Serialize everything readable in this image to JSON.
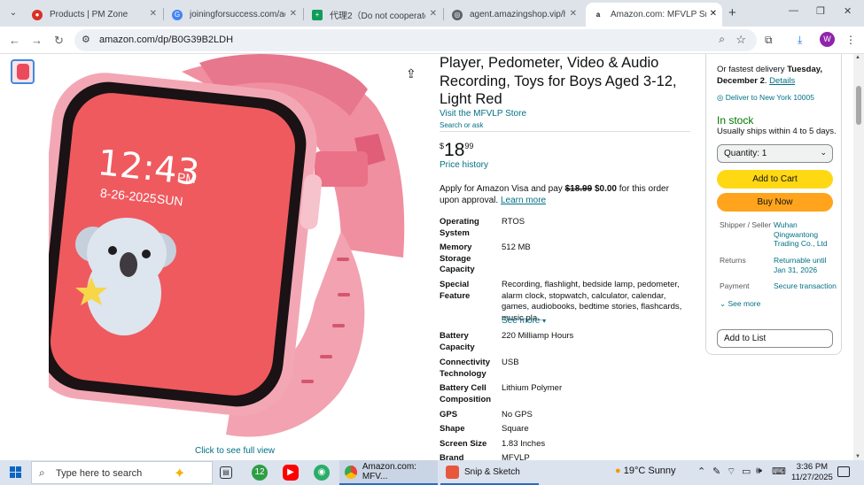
{
  "browser": {
    "tabs": [
      {
        "title": "Products | PM Zone",
        "favicon_color": "#d93025"
      },
      {
        "title": "joiningforsuccess.com/adm",
        "favicon_color": "#4285f4"
      },
      {
        "title": "代理2（Do not cooperate w",
        "favicon_color": "#0f9d58"
      },
      {
        "title": "agent.amazingshop.vip/hon",
        "favicon_color": "#5f6368"
      },
      {
        "title": "Amazon.com: MFVLP Smart",
        "favicon_color": "#111111"
      }
    ],
    "url": "amazon.com/dp/B0G39B2LDH",
    "profile_initial": "W"
  },
  "product": {
    "title": "Player, Pedometer, Video & Audio Recording, Toys for Boys Aged 3-12, Light Red",
    "store_link": "Visit the MFVLP Store",
    "search_or_ask": "Search or ask",
    "price_symbol": "$",
    "price_whole": "18",
    "price_fraction": "99",
    "price_history": "Price history",
    "visa_prefix": "Apply for Amazon Visa and pay ",
    "visa_old_price": "$18.99",
    "visa_new_price": "$0.00",
    "visa_suffix": " for this order upon approval. ",
    "learn_more": "Learn more",
    "see_more": "See more",
    "full_view": "Click to see full view",
    "watch_time": "12:43",
    "watch_ampm": "PM",
    "watch_date": "8-26-2025",
    "watch_day": "SUN",
    "specs": [
      {
        "key": "Operating System",
        "value": "RTOS"
      },
      {
        "key": "Memory Storage Capacity",
        "value": "512 MB"
      },
      {
        "key": "Special Feature",
        "value": "Recording, flashlight, bedside lamp, pedometer, alarm clock, stopwatch, calculator, calendar, games, audiobooks, bedtime stories, flashcards, music pla..."
      },
      {
        "key": "Battery Capacity",
        "value": "220 Milliamp Hours"
      },
      {
        "key": "Connectivity Technology",
        "value": "USB"
      },
      {
        "key": "Battery Cell Composition",
        "value": "Lithium Polymer"
      },
      {
        "key": "GPS",
        "value": "No GPS"
      },
      {
        "key": "Shape",
        "value": "Square"
      },
      {
        "key": "Screen Size",
        "value": "1.83 Inches"
      },
      {
        "key": "Brand",
        "value": "MFVLP"
      }
    ]
  },
  "buybox": {
    "delivery_prefix": "Or fastest delivery ",
    "delivery_date": "Tuesday, December 2",
    "delivery_sep": ". ",
    "details": "Details",
    "deliver_to": "Deliver to New York 10005",
    "in_stock": "In stock",
    "ships": "Usually ships within 4 to 5 days.",
    "quantity": "Quantity: 1",
    "add_to_cart": "Add to Cart",
    "buy_now": "Buy Now",
    "shipper_label": "Shipper / Seller",
    "shipper_value": "Wuhan Qingwantong Trading Co., Ltd",
    "returns_label": "Returns",
    "returns_value": "Returnable until Jan 31, 2026",
    "payment_label": "Payment",
    "payment_value": "Secure transaction",
    "see_more": "See more",
    "add_to_list": "Add to List"
  },
  "taskbar": {
    "search_placeholder": "Type here to search",
    "apps": [
      {
        "label": "Amazon.com: MFV..."
      },
      {
        "label": "Snip & Sketch"
      }
    ],
    "weather": "19°C  Sunny",
    "time": "3:36 PM",
    "date": "11/27/2025"
  },
  "colors": {
    "link": "#007185",
    "in_stock": "#007600",
    "cart_button": "#ffd814",
    "buy_button": "#ffa41c"
  }
}
